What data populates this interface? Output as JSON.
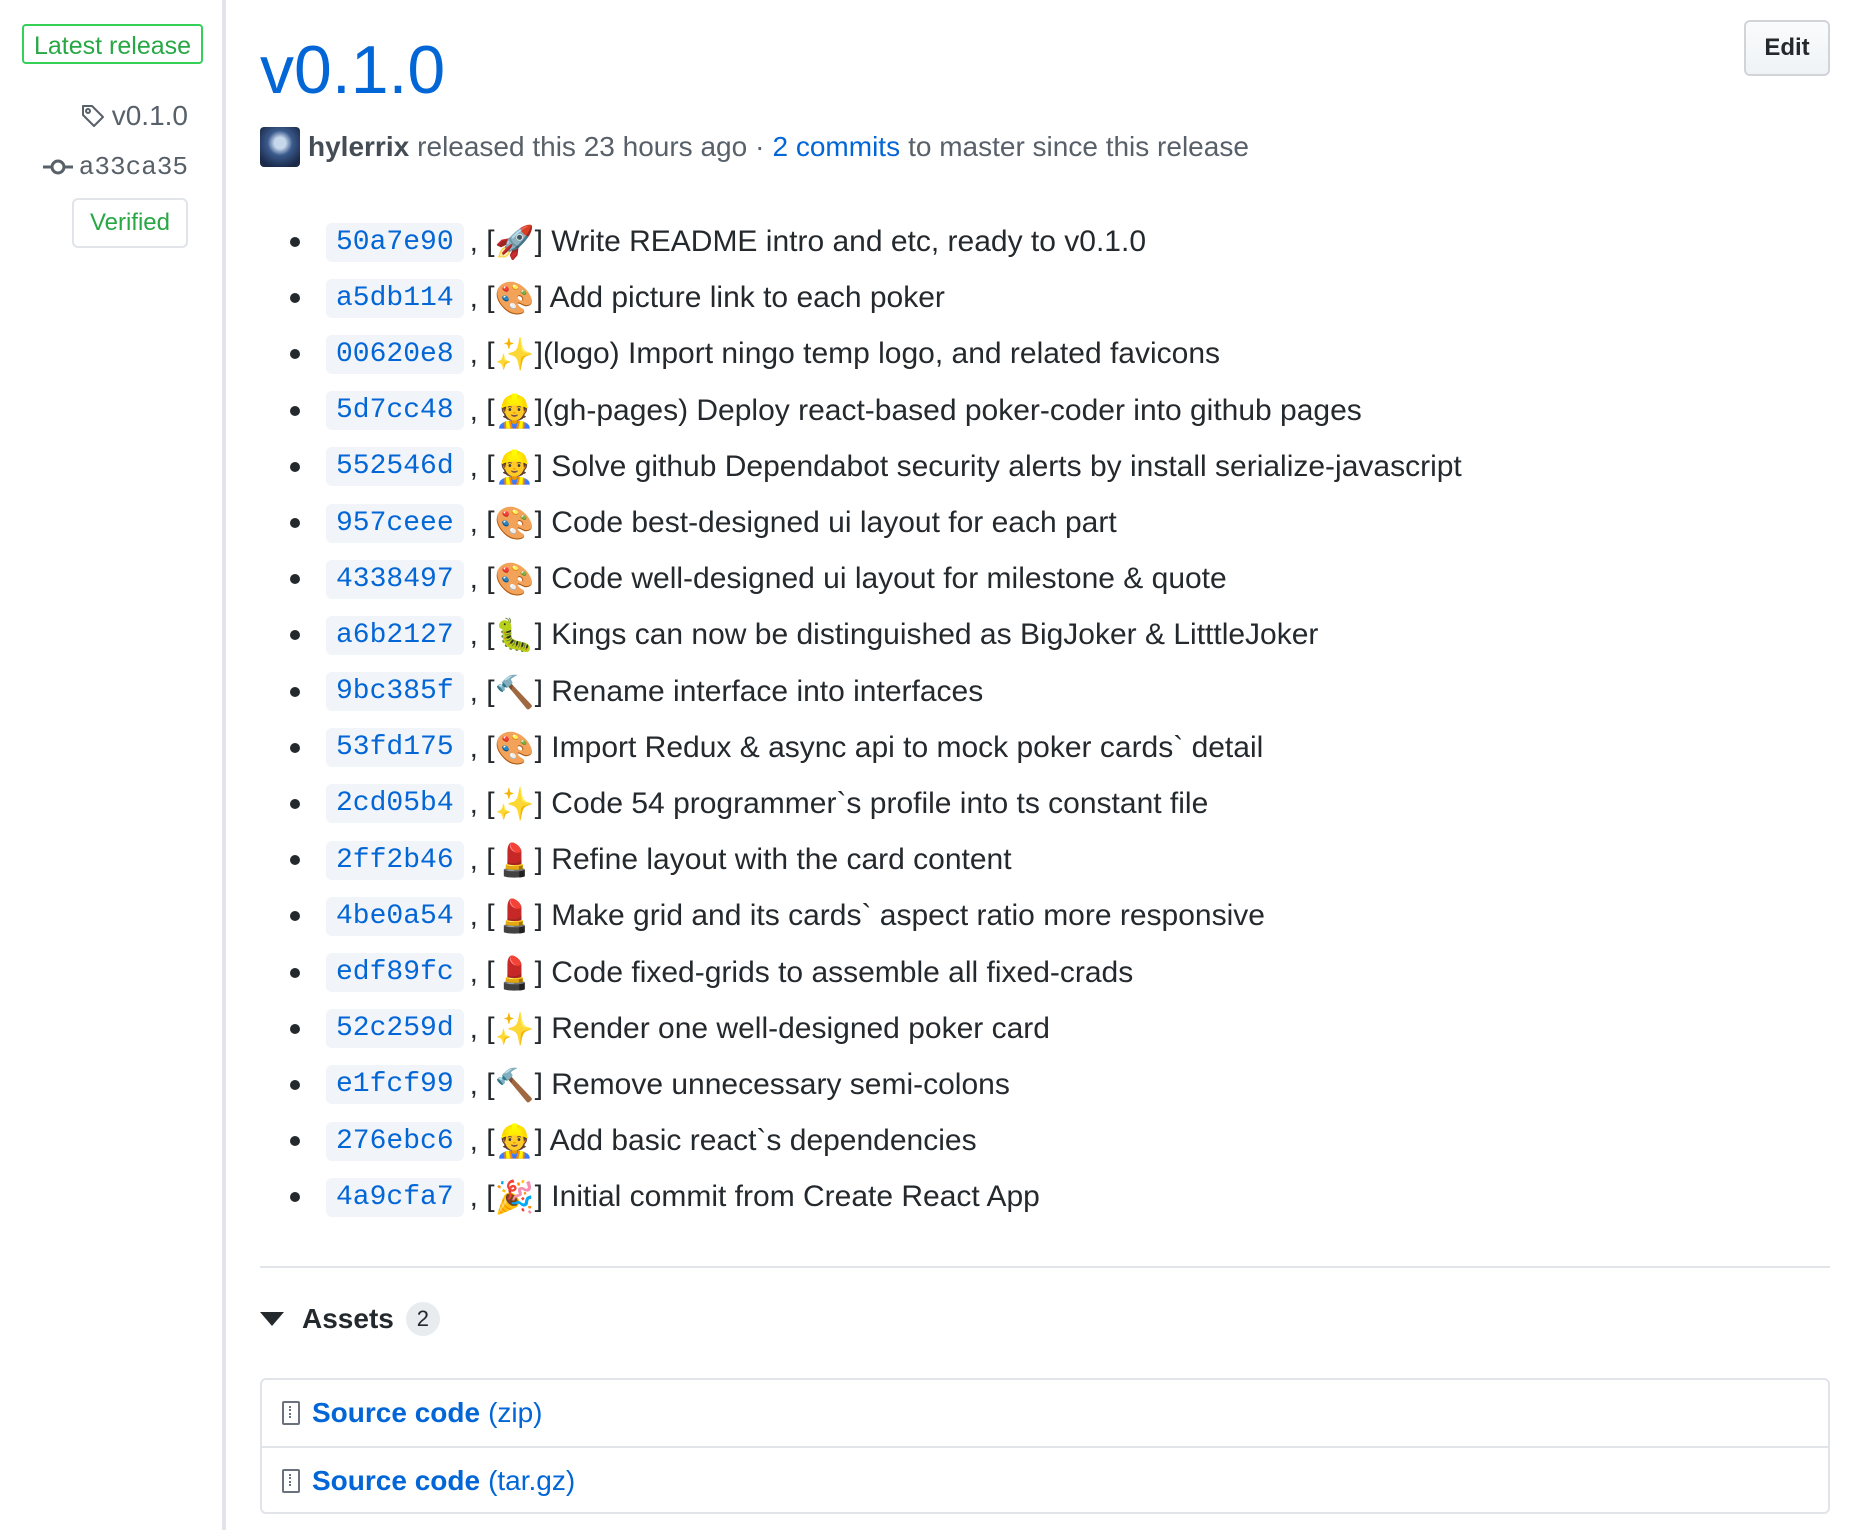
{
  "sidebar": {
    "badge": "Latest release",
    "tag": "v0.1.0",
    "commit": "a33ca35",
    "verified": "Verified"
  },
  "header": {
    "title": "v0.1.0",
    "edit_label": "Edit",
    "author": "hylerrix",
    "released_text": "released this 23 hours ago",
    "separator": "·",
    "commits_link": "2 commits",
    "commits_suffix": "to master since this release"
  },
  "commits": [
    {
      "sha": "50a7e90",
      "emoji": "🚀",
      "emoji_name": "rocket-emoji",
      "message": "] Write README intro and etc, ready to v0.1.0"
    },
    {
      "sha": "a5db114",
      "emoji": "🎨",
      "emoji_name": "palette-emoji",
      "message": "] Add picture link to each poker"
    },
    {
      "sha": "00620e8",
      "emoji": "✨",
      "emoji_name": "sparkles-emoji",
      "message": "](logo) Import ningo temp logo, and related favicons"
    },
    {
      "sha": "5d7cc48",
      "emoji": "👷",
      "emoji_name": "construction-worker-emoji",
      "message": "](gh-pages) Deploy react-based poker-coder into github pages"
    },
    {
      "sha": "552546d",
      "emoji": "👷",
      "emoji_name": "construction-worker-emoji",
      "message": "] Solve github Dependabot security alerts by install serialize-javascript"
    },
    {
      "sha": "957ceee",
      "emoji": "🎨",
      "emoji_name": "palette-emoji",
      "message": "] Code best-designed ui layout for each part"
    },
    {
      "sha": "4338497",
      "emoji": "🎨",
      "emoji_name": "palette-emoji",
      "message": "] Code well-designed ui layout for milestone & quote"
    },
    {
      "sha": "a6b2127",
      "emoji": "🐛",
      "emoji_name": "bug-emoji",
      "message": "] Kings can now be distinguished as BigJoker & LitttleJoker"
    },
    {
      "sha": "9bc385f",
      "emoji": "🔨",
      "emoji_name": "hammer-emoji",
      "message": "] Rename interface into interfaces"
    },
    {
      "sha": "53fd175",
      "emoji": "🎨",
      "emoji_name": "palette-emoji",
      "message": "] Import Redux & async api to mock poker cards` detail"
    },
    {
      "sha": "2cd05b4",
      "emoji": "✨",
      "emoji_name": "sparkles-emoji",
      "message": "] Code 54 programmer`s profile into ts constant file"
    },
    {
      "sha": "2ff2b46",
      "emoji": "💄",
      "emoji_name": "lipstick-emoji",
      "message": "] Refine layout with the card content"
    },
    {
      "sha": "4be0a54",
      "emoji": "💄",
      "emoji_name": "lipstick-emoji",
      "message": "] Make grid and its cards` aspect ratio more responsive"
    },
    {
      "sha": "edf89fc",
      "emoji": "💄",
      "emoji_name": "lipstick-emoji",
      "message": "] Code fixed-grids to assemble all fixed-crads"
    },
    {
      "sha": "52c259d",
      "emoji": "✨",
      "emoji_name": "sparkles-emoji",
      "message": "] Render one well-designed poker card"
    },
    {
      "sha": "e1fcf99",
      "emoji": "🔨",
      "emoji_name": "hammer-emoji",
      "message": "] Remove unnecessary semi-colons"
    },
    {
      "sha": "276ebc6",
      "emoji": "👷",
      "emoji_name": "construction-worker-emoji",
      "message": "] Add basic react`s dependencies"
    },
    {
      "sha": "4a9cfa7",
      "emoji": "🎉",
      "emoji_name": "tada-emoji",
      "message": "] Initial commit from Create React App"
    }
  ],
  "assets": {
    "title": "Assets",
    "count": "2",
    "items": [
      {
        "name": "Source code",
        "type": "(zip)"
      },
      {
        "name": "Source code",
        "type": "(tar.gz)"
      }
    ]
  },
  "colors": {
    "link": "#0366d6",
    "verified": "#28a745",
    "text": "#24292e",
    "muted": "#586069"
  }
}
